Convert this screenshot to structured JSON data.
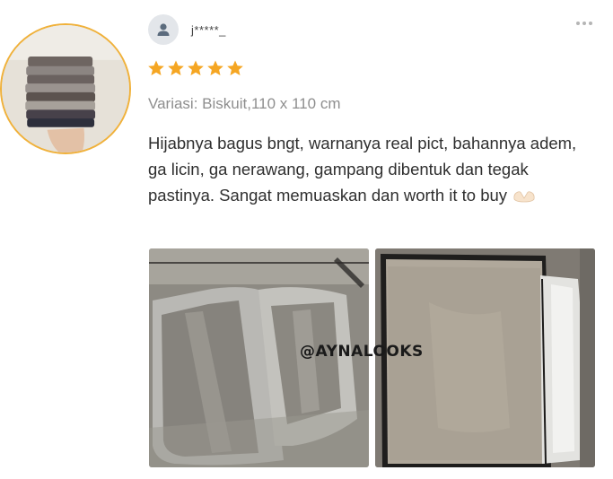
{
  "reviewer": {
    "name": "j*****_",
    "avatar_icon": "user-icon"
  },
  "rating": {
    "stars": 5,
    "max": 5,
    "color": "#f5a623"
  },
  "variant": "Variasi: Biskuit,110 x 110 cm",
  "review_text": "Hijabnya bagus bngt, warnanya real pict, bahannya adem, ga licin, ga nerawang, gampang dibentuk dan tegak pastinya. Sangat memuaskan dan worth it to buy",
  "review_emoji_icon": "heart-hands-icon",
  "watermark": "@AYNALOOKS",
  "menu_icon": "more-dots-icon",
  "colors": {
    "accent": "#f0b13a",
    "star": "#f5a623",
    "variant_text": "#8e8e8e"
  }
}
